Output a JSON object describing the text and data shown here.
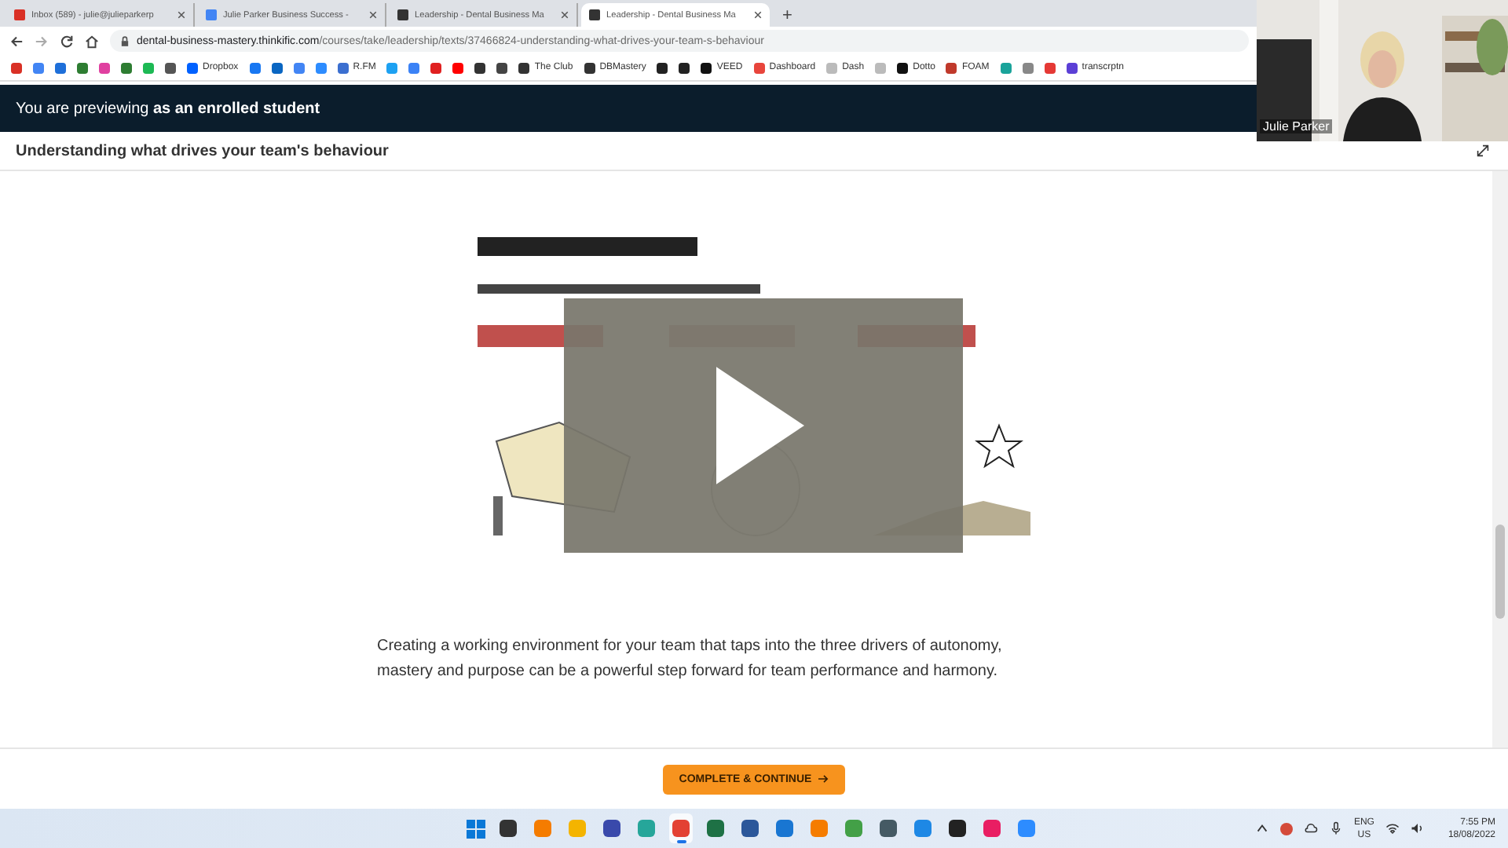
{
  "browser": {
    "tabs": [
      {
        "title": "Inbox (589) - julie@julieparkerp",
        "color": "#d93025",
        "selected": false
      },
      {
        "title": "Julie Parker Business Success -",
        "color": "#4285f4",
        "selected": false
      },
      {
        "title": "Leadership - Dental Business Ma",
        "color": "#333333",
        "selected": false
      },
      {
        "title": "Leadership - Dental Business Ma",
        "color": "#333333",
        "selected": true
      }
    ],
    "new_tab": "+",
    "url_domain": "dental-business-mastery.thinkific.com",
    "url_path": "/courses/take/leadership/texts/37466824-understanding-what-drives-your-team-s-behaviour",
    "bookmarks": [
      {
        "color": "#d93025"
      },
      {
        "color": "#4285f4"
      },
      {
        "color": "#1e6fd9"
      },
      {
        "color": "#2e7d32"
      },
      {
        "color": "#e040a0"
      },
      {
        "color": "#2e7d32"
      },
      {
        "color": "#1db954"
      },
      {
        "color": "#555555"
      },
      {
        "label": "Dropbox",
        "color": "#0061ff"
      },
      {
        "color": "#1877f2"
      },
      {
        "color": "#0a66c2"
      },
      {
        "color": "#4285f4"
      },
      {
        "color": "#2d8cff"
      },
      {
        "label": "R.FM",
        "color": "#3b6fd0"
      },
      {
        "color": "#1da1f2"
      },
      {
        "color": "#3b82f6"
      },
      {
        "color": "#e02020"
      },
      {
        "color": "#ff0000"
      },
      {
        "color": "#333333"
      },
      {
        "color": "#444444"
      },
      {
        "label": "The Club",
        "color": "#333333"
      },
      {
        "label": "DBMastery",
        "color": "#333333"
      },
      {
        "color": "#222222"
      },
      {
        "color": "#222222"
      },
      {
        "label": "VEED",
        "color": "#111111"
      },
      {
        "label": "Dashboard",
        "color": "#e8453c"
      },
      {
        "label": "Dash",
        "color": "#bbbbbb"
      },
      {
        "color": "#bbbbbb"
      },
      {
        "label": "Dotto",
        "color": "#111111"
      },
      {
        "label": "FOAM",
        "color": "#c0392b"
      },
      {
        "color": "#1aa39a"
      },
      {
        "color": "#888888"
      },
      {
        "color": "#e53935"
      },
      {
        "label": "transcrptn",
        "color": "#5b3fd6"
      }
    ]
  },
  "webcam": {
    "name": "Julie Parker"
  },
  "preview_banner": "You are previewing **as an enrolled student**",
  "lesson_title": "Understanding what drives your team's behaviour",
  "paragraph": "Creating a working environment for your team that taps into the three drivers of autonomy, mastery and purpose can be a powerful step forward for team performance and harmony.",
  "complete_button": "COMPLETE & CONTINUE",
  "taskbar": {
    "apps": [
      {
        "color": "#333333",
        "active": false
      },
      {
        "color": "#f57c00",
        "active": false
      },
      {
        "color": "#f4b400",
        "active": false
      },
      {
        "color": "#3949ab",
        "active": false
      },
      {
        "color": "#26a69a",
        "active": false
      },
      {
        "color": "#e34133",
        "active": true
      },
      {
        "color": "#1e7145",
        "active": false
      },
      {
        "color": "#2b579a",
        "active": false
      },
      {
        "color": "#1976d2",
        "active": false
      },
      {
        "color": "#f57c00",
        "active": false
      },
      {
        "color": "#43a047",
        "active": false
      },
      {
        "color": "#455a64",
        "active": false
      },
      {
        "color": "#1e88e5",
        "active": false
      },
      {
        "color": "#222222",
        "active": false
      },
      {
        "color": "#e91e63",
        "active": false
      },
      {
        "color": "#2d8cff",
        "active": false
      }
    ],
    "language": "ENG",
    "region": "US",
    "time": "7:55 PM",
    "date": "18/08/2022"
  }
}
